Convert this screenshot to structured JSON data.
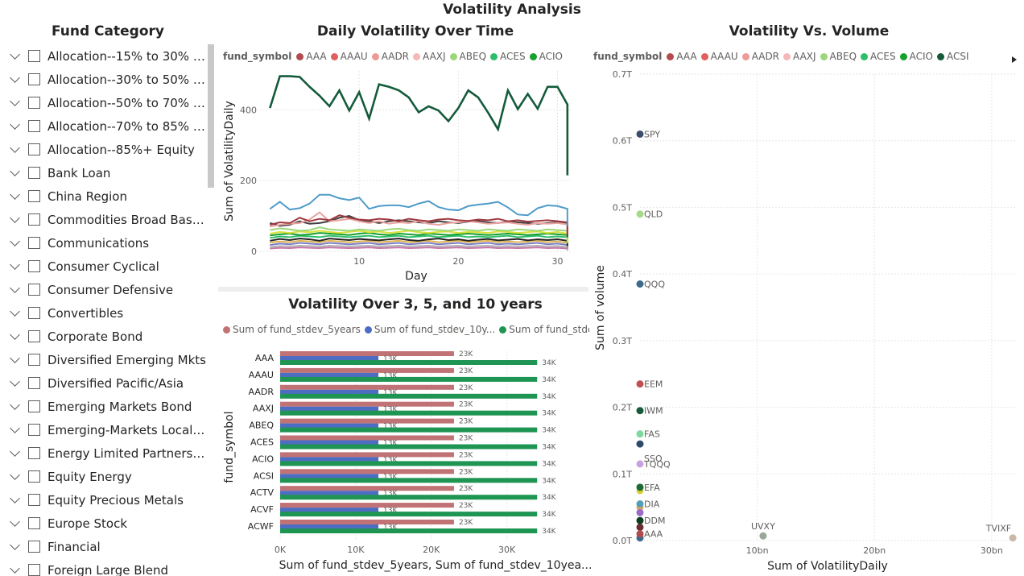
{
  "page": {
    "title": "Volatility Analysis"
  },
  "slicer": {
    "title": "Fund Category",
    "items": [
      "Allocation--15% to 30% Equ...",
      "Allocation--30% to 50% Equ...",
      "Allocation--50% to 70% Equ...",
      "Allocation--70% to 85% Equ...",
      "Allocation--85%+ Equity",
      "Bank Loan",
      "China Region",
      "Commodities Broad Basket",
      "Communications",
      "Consumer Cyclical",
      "Consumer Defensive",
      "Convertibles",
      "Corporate Bond",
      "Diversified Emerging Mkts",
      "Diversified Pacific/Asia",
      "Emerging Markets Bond",
      "Emerging-Markets Local-C...",
      "Energy Limited Partnership",
      "Equity Energy",
      "Equity Precious Metals",
      "Europe Stock",
      "Financial",
      "Foreign Large Blend"
    ]
  },
  "legend_symbols": {
    "title": "fund_symbol",
    "items": [
      {
        "label": "AAA",
        "color": "#b34a4f"
      },
      {
        "label": "AAAU",
        "color": "#e0605e"
      },
      {
        "label": "AADR",
        "color": "#ee9a97"
      },
      {
        "label": "AAXJ",
        "color": "#f4b8b8"
      },
      {
        "label": "ABEQ",
        "color": "#9bd77a"
      },
      {
        "label": "ACES",
        "color": "#2dbe6c"
      },
      {
        "label": "ACIO",
        "color": "#17a02d"
      },
      {
        "label": "ACSI",
        "color": "#145b3b"
      }
    ]
  },
  "line_chart": {
    "title": "Daily Volatility Over Time",
    "xlabel": "Day",
    "ylabel": "Sum of VolatilityDaily",
    "chart_data": {
      "type": "line",
      "x_range": [
        0,
        31.5
      ],
      "y_range": [
        0,
        510
      ],
      "x_ticks": [
        "10",
        "20",
        "30"
      ],
      "y_ticks": [
        "0",
        "200",
        "400"
      ],
      "x": [
        1,
        2,
        3,
        4,
        5,
        6,
        7,
        8,
        9,
        10,
        11,
        12,
        13,
        14,
        15,
        16,
        17,
        18,
        19,
        20,
        21,
        22,
        23,
        24,
        25,
        26,
        27,
        28,
        29,
        30,
        31
      ],
      "series": [
        {
          "color": "#145b3b",
          "values": [
            405,
            495,
            495,
            493,
            465,
            440,
            410,
            455,
            398,
            450,
            375,
            472,
            465,
            455,
            435,
            393,
            410,
            398,
            368,
            405,
            455,
            435,
            392,
            345,
            455,
            402,
            445,
            403,
            465,
            465,
            415,
            215
          ]
        },
        {
          "color": "#4f9bc9",
          "values": [
            120,
            140,
            118,
            122,
            135,
            160,
            160,
            150,
            145,
            152,
            120,
            128,
            130,
            130,
            125,
            135,
            142,
            125,
            118,
            116,
            128,
            132,
            135,
            140,
            124,
            104,
            102,
            122,
            130,
            128,
            120,
            72
          ]
        },
        {
          "color": "#a0393f",
          "values": [
            75,
            82,
            80,
            95,
            85,
            92,
            88,
            102,
            95,
            90,
            88,
            92,
            90,
            85,
            92,
            88,
            85,
            90,
            92,
            88,
            86,
            90,
            88,
            92,
            85,
            88,
            84,
            86,
            88,
            85,
            82,
            45
          ]
        },
        {
          "color": "#e9a3a0",
          "values": [
            70,
            75,
            78,
            80,
            90,
            110,
            85,
            88,
            92,
            85,
            80,
            85,
            78,
            82,
            80,
            85,
            78,
            75,
            80,
            82,
            85,
            82,
            78,
            80,
            82,
            78,
            75,
            80,
            78,
            80,
            76,
            50
          ]
        },
        {
          "color": "#404040",
          "values": [
            80,
            72,
            75,
            85,
            78,
            80,
            85,
            95,
            100,
            88,
            85,
            80,
            85,
            88,
            85,
            82,
            80,
            85,
            82,
            80,
            84,
            86,
            82,
            80,
            84,
            82,
            80,
            78,
            80,
            82,
            80,
            40
          ]
        },
        {
          "color": "#9bd77a",
          "values": [
            60,
            65,
            62,
            58,
            60,
            68,
            62,
            60,
            58,
            62,
            60,
            58,
            62,
            64,
            60,
            58,
            62,
            60,
            58,
            62,
            60,
            58,
            62,
            60,
            58,
            62,
            60,
            58,
            62,
            60,
            58,
            35
          ]
        },
        {
          "color": "#d9e23a",
          "values": [
            50,
            55,
            52,
            56,
            54,
            58,
            55,
            52,
            55,
            58,
            54,
            56,
            52,
            55,
            58,
            54,
            52,
            55,
            56,
            52,
            55,
            54,
            52,
            56,
            55,
            52,
            54,
            56,
            52,
            55,
            50,
            25
          ]
        },
        {
          "color": "#17a02d",
          "values": [
            45,
            48,
            50,
            46,
            48,
            52,
            50,
            48,
            46,
            50,
            52,
            48,
            46,
            50,
            48,
            46,
            50,
            48,
            46,
            48,
            50,
            48,
            46,
            48,
            50,
            48,
            46,
            48,
            50,
            48,
            46,
            30
          ]
        },
        {
          "color": "#2dbe6c",
          "values": [
            38,
            42,
            40,
            44,
            42,
            40,
            44,
            42,
            40,
            42,
            44,
            40,
            42,
            44,
            40,
            42,
            44,
            40,
            42,
            44,
            40,
            42,
            40,
            42,
            44,
            40,
            42,
            44,
            40,
            42,
            40,
            22
          ]
        },
        {
          "color": "#252423",
          "values": [
            30,
            35,
            32,
            36,
            34,
            30,
            36,
            34,
            32,
            35,
            33,
            31,
            34,
            36,
            32,
            30,
            34,
            36,
            32,
            34,
            30,
            33,
            35,
            31,
            33,
            35,
            31,
            34,
            32,
            34,
            30,
            15
          ]
        },
        {
          "color": "#e0b24f",
          "values": [
            25,
            28,
            26,
            30,
            28,
            26,
            30,
            28,
            26,
            28,
            30,
            26,
            28,
            30,
            26,
            28,
            30,
            26,
            28,
            30,
            26,
            28,
            30,
            26,
            28,
            26,
            28,
            30,
            26,
            28,
            24,
            12
          ]
        },
        {
          "color": "#7a7fc8",
          "values": [
            18,
            22,
            20,
            24,
            22,
            20,
            24,
            22,
            20,
            22,
            24,
            20,
            22,
            24,
            20,
            22,
            24,
            20,
            22,
            24,
            20,
            22,
            24,
            20,
            22,
            20,
            22,
            24,
            20,
            22,
            18,
            8
          ]
        },
        {
          "color": "#b3b3b3",
          "values": [
            12,
            15,
            14,
            16,
            15,
            14,
            16,
            15,
            14,
            15,
            16,
            14,
            15,
            16,
            14,
            15,
            16,
            14,
            15,
            16,
            14,
            15,
            16,
            14,
            15,
            14,
            15,
            16,
            14,
            15,
            12,
            5
          ]
        },
        {
          "color": "#c874a8",
          "values": [
            8,
            10,
            9,
            11,
            10,
            9,
            11,
            10,
            9,
            10,
            11,
            9,
            10,
            11,
            9,
            10,
            11,
            9,
            10,
            11,
            9,
            10,
            11,
            9,
            10,
            9,
            10,
            11,
            9,
            10,
            8,
            3
          ]
        }
      ]
    }
  },
  "bar_chart": {
    "title": "Volatility Over 3, 5, and 10 years",
    "legend": [
      {
        "label": "Sum of fund_stdev_5years",
        "color": "#c07275"
      },
      {
        "label": "Sum of fund_stdev_10y...",
        "color": "#4d6dc2"
      },
      {
        "label": "Sum of fund_stde",
        "color": "#1f9553"
      }
    ],
    "xlabel": "Sum of fund_stdev_5years, Sum of fund_stdev_10yea...",
    "ylabel": "fund_symbol",
    "chart_data": {
      "type": "bar",
      "orientation": "horizontal",
      "categories": [
        "AAA",
        "AAAU",
        "AADR",
        "AAXJ",
        "ABEQ",
        "ACES",
        "ACIO",
        "ACSI",
        "ACTV",
        "ACVF",
        "ACWF"
      ],
      "x_range": [
        0,
        36000
      ],
      "x_ticks": [
        "0K",
        "10K",
        "20K",
        "30K"
      ],
      "series": [
        {
          "name": "Sum of fund_stdev_5years",
          "color": "#c07275",
          "values": [
            23000,
            23000,
            23000,
            23000,
            23000,
            23000,
            23000,
            23000,
            23000,
            23000,
            23000
          ],
          "label": "23K"
        },
        {
          "name": "Sum of fund_stdev_10y...",
          "color": "#4d6dc2",
          "values": [
            13000,
            13000,
            13000,
            13000,
            13000,
            13000,
            13000,
            13000,
            13000,
            13000,
            13000
          ],
          "label": "13K"
        },
        {
          "name": "Sum of fund_stde",
          "color": "#1f9553",
          "values": [
            34000,
            34000,
            34000,
            34000,
            34000,
            34000,
            34000,
            34000,
            34000,
            34000,
            34000
          ],
          "label": "34K"
        }
      ]
    }
  },
  "scatter_chart": {
    "title": "Volatility Vs. Volume",
    "xlabel": "Sum of VolatilityDaily",
    "ylabel": "Sum of volume",
    "legend_more_icon": "chevron-right-icon",
    "chart_data": {
      "type": "scatter",
      "x_range": [
        0,
        32
      ],
      "y_range": [
        0,
        0.7
      ],
      "x_ticks": [
        "10bn",
        "20bn",
        "30bn"
      ],
      "y_ticks": [
        "0.0T",
        "0.1T",
        "0.2T",
        "0.3T",
        "0.4T",
        "0.5T",
        "0.6T",
        "0.7T"
      ],
      "points": [
        {
          "label": "SPY",
          "x": 0,
          "y": 0.61,
          "color": "#3b4e6b"
        },
        {
          "label": "QLD",
          "x": 0,
          "y": 0.49,
          "color": "#a7d98a"
        },
        {
          "label": "QQQ",
          "x": 0,
          "y": 0.385,
          "color": "#3b6a8c"
        },
        {
          "label": "EEM",
          "x": 0,
          "y": 0.235,
          "color": "#c0504d"
        },
        {
          "label": "IWM",
          "x": 0,
          "y": 0.195,
          "color": "#145b3b"
        },
        {
          "label": "FAS",
          "x": 0,
          "y": 0.16,
          "color": "#7fd8a0"
        },
        {
          "label": "SSO",
          "x": 0,
          "y": 0.145,
          "color": "#2e4a6b"
        },
        {
          "label": "TQQQ",
          "x": 0,
          "y": 0.115,
          "color": "#c8a2e0"
        },
        {
          "label": "EFA",
          "x": 0,
          "y": 0.08,
          "color": "#1d6b33"
        },
        {
          "label": "DIA",
          "x": 0,
          "y": 0.055,
          "color": "#52a0b8"
        },
        {
          "label": "DDM",
          "x": 0,
          "y": 0.03,
          "color": "#0f3d20"
        },
        {
          "label": "AAA",
          "x": 0,
          "y": 0.01,
          "color": "#b34a4f"
        },
        {
          "label": "UVXY",
          "x": 10.5,
          "y": 0.007,
          "color": "#9aa79a"
        },
        {
          "label": "TVIXF",
          "x": 31.8,
          "y": 0.004,
          "color": "#c8b8a8"
        }
      ],
      "extra_points": [
        {
          "x": 0,
          "y": 0.075,
          "color": "#d4d13a"
        },
        {
          "x": 0,
          "y": 0.05,
          "color": "#e6a85a"
        },
        {
          "x": 0,
          "y": 0.042,
          "color": "#9c6cc4"
        },
        {
          "x": 0,
          "y": 0.02,
          "color": "#6b2d2d"
        },
        {
          "x": 0,
          "y": 0.004,
          "color": "#3b6a8c"
        }
      ]
    }
  }
}
